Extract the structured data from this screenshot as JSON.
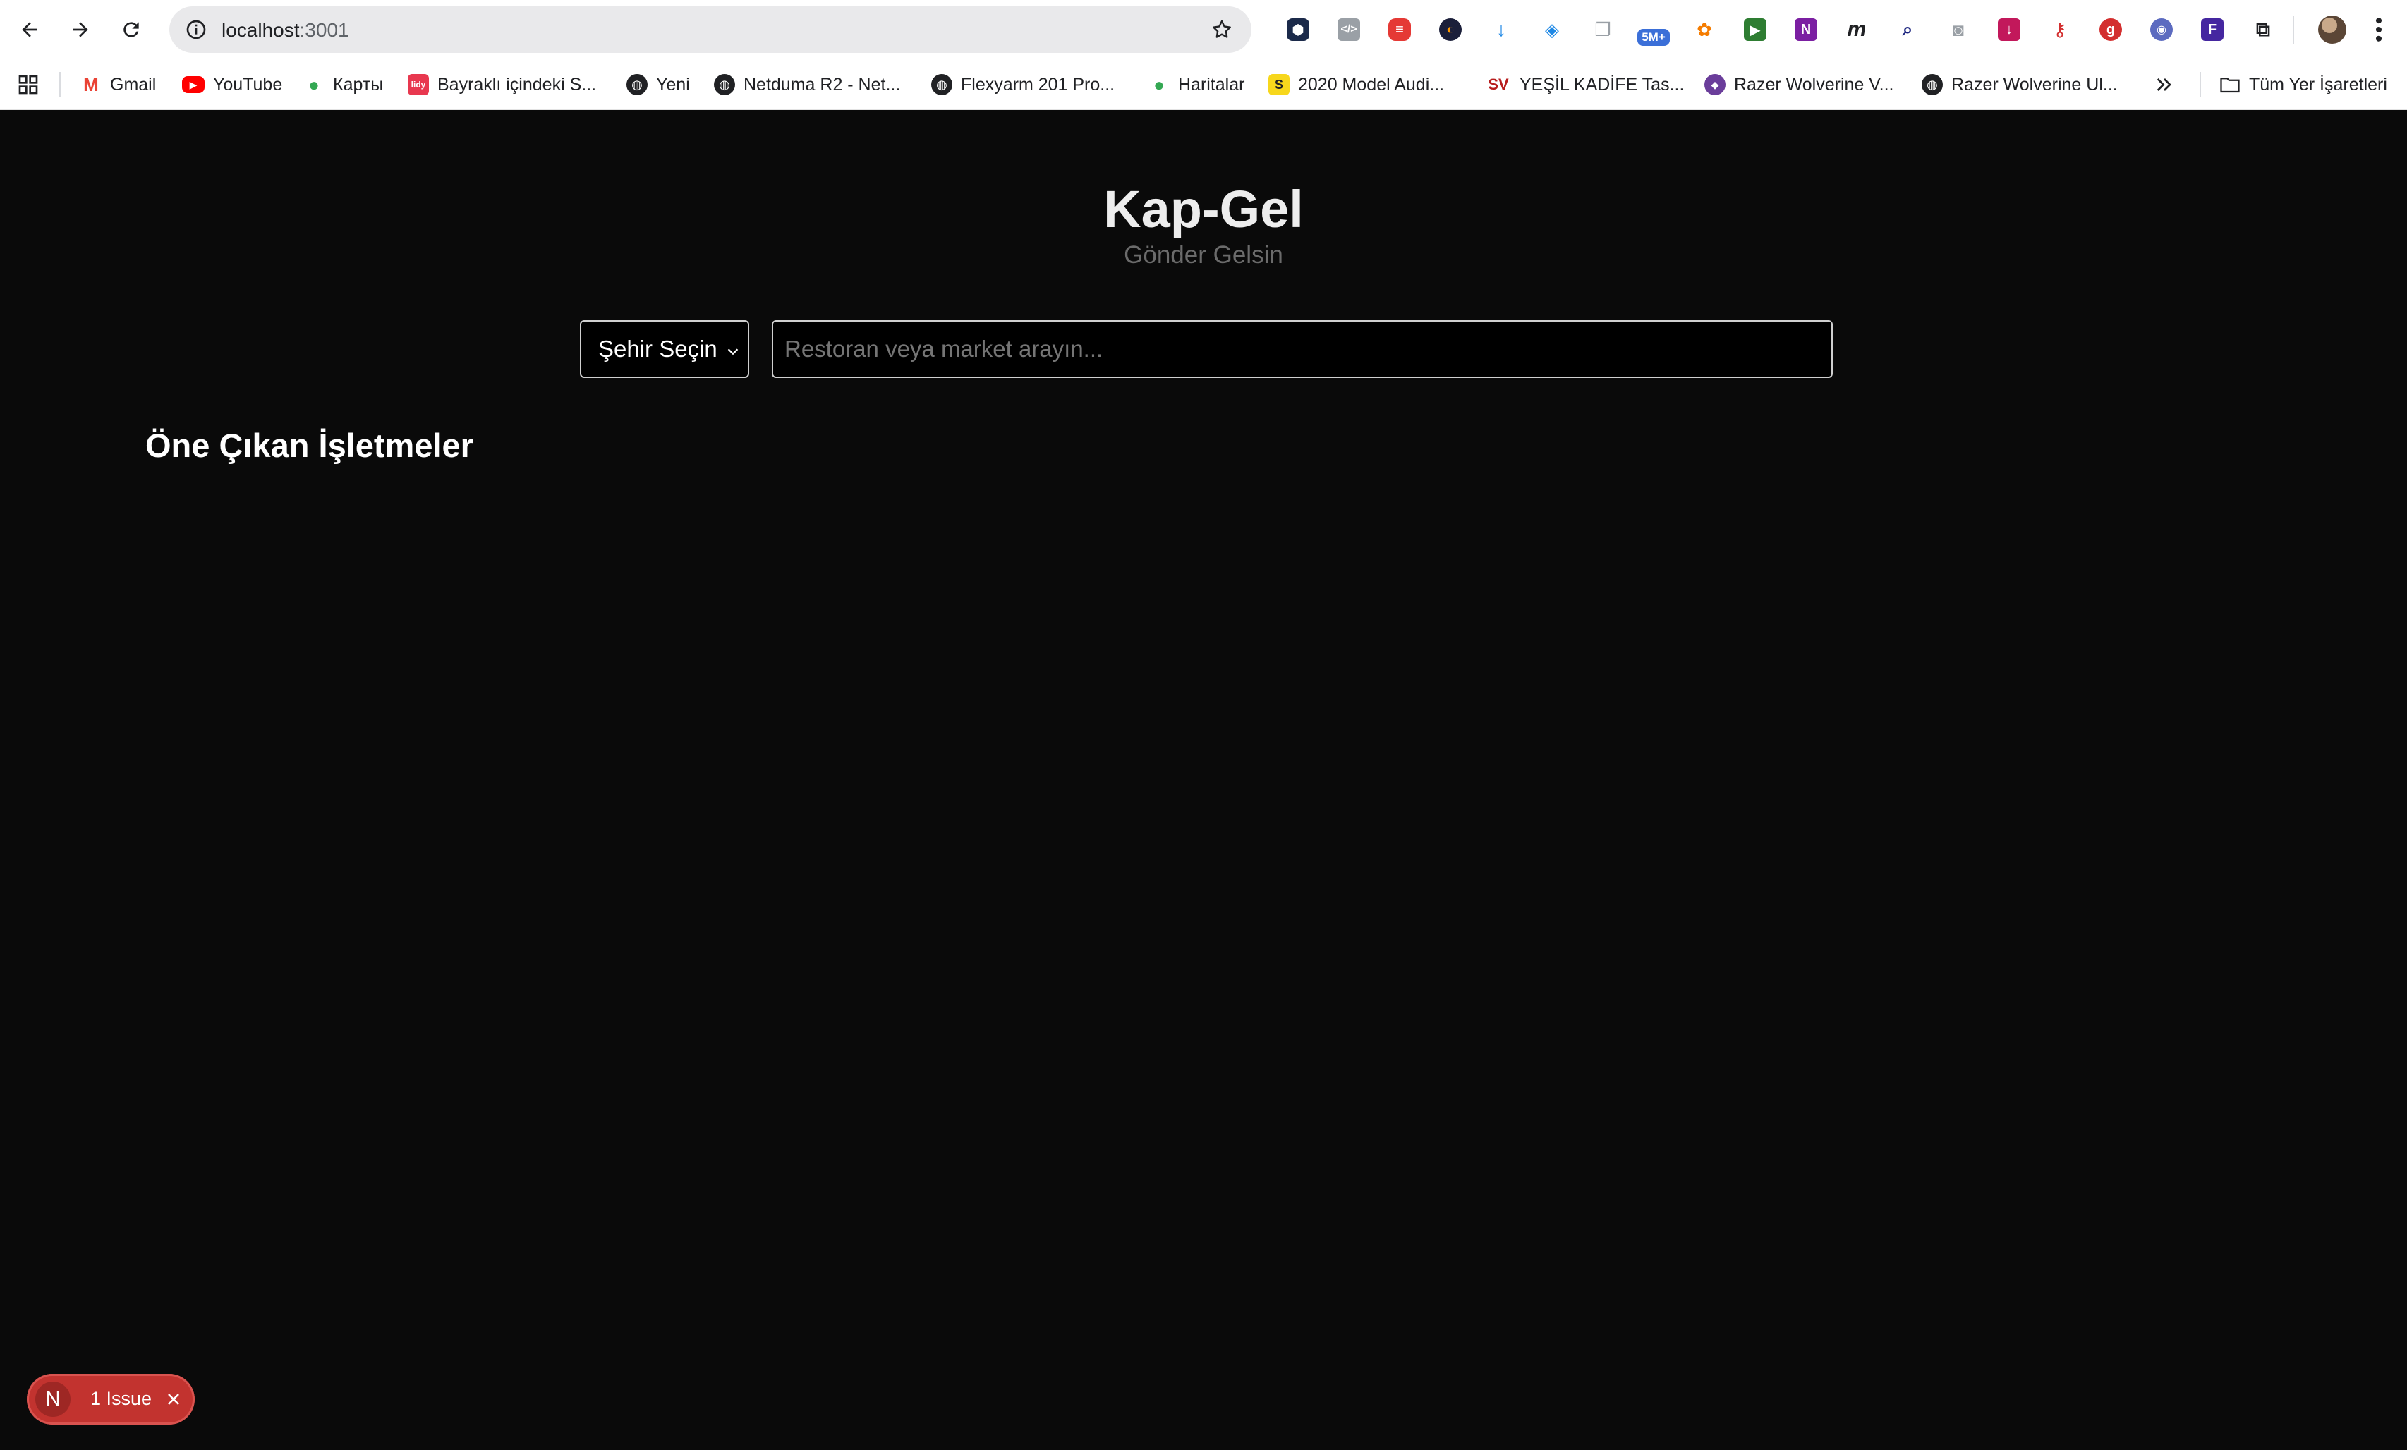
{
  "browser": {
    "url_host": "localhost",
    "url_port": ":3001",
    "extensions_badge": "5M+"
  },
  "bookmarks": [
    {
      "label": "Gmail",
      "icon": "gmail-icon",
      "color": "#ea4335"
    },
    {
      "label": "YouTube",
      "icon": "youtube-icon",
      "color": "#ff0000"
    },
    {
      "label": "Карты",
      "icon": "maps-pin-icon",
      "color": "#34a853"
    },
    {
      "label": "Bayraklı içindeki S...",
      "icon": "site-icon",
      "color": "#e8384f"
    },
    {
      "label": "Yeni",
      "icon": "globe-icon",
      "color": "#202124"
    },
    {
      "label": "Netduma R2 - Net...",
      "icon": "globe-icon",
      "color": "#202124"
    },
    {
      "label": "Flexyarm 201 Pro...",
      "icon": "globe-icon",
      "color": "#202124"
    },
    {
      "label": "Haritalar",
      "icon": "maps-pin-icon",
      "color": "#34a853"
    },
    {
      "label": "2020 Model Audi...",
      "icon": "s-icon",
      "color": "#f7d71c"
    },
    {
      "label": "YEŞİL KADİFE Tas...",
      "icon": "sv-icon",
      "color": "#b71c1c"
    },
    {
      "label": "Razer Wolverine V...",
      "icon": "razer-icon",
      "color": "#6a3d9a"
    },
    {
      "label": "Razer Wolverine Ul...",
      "icon": "globe-icon",
      "color": "#202124"
    }
  ],
  "bookmarks_folder": "Tüm Yer İşaretleri",
  "app": {
    "title": "Kap-Gel",
    "subtitle": "Gönder Gelsin",
    "city_select": "Şehir Seçin",
    "search_placeholder": "Restoran veya market arayın...",
    "section_title": "Öne Çıkan İşletmeler"
  },
  "dev_overlay": {
    "logo": "N",
    "issues_label": "1 Issue"
  },
  "colors": {
    "page_bg": "#0a0a0a",
    "issue_red": "#c2332f"
  }
}
